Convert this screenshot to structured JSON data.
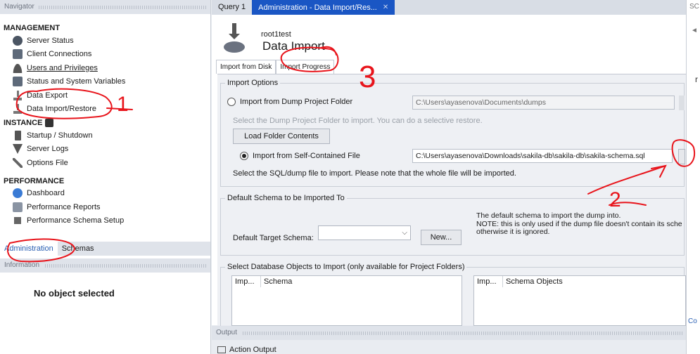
{
  "navigator": {
    "header": "Navigator",
    "sections": [
      {
        "title": "MANAGEMENT",
        "items": [
          {
            "label": "Server Status",
            "icon": "server-status-icon"
          },
          {
            "label": "Client Connections",
            "icon": "client-connections-icon"
          },
          {
            "label": "Users and Privileges",
            "icon": "users-icon"
          },
          {
            "label": "Status and System Variables",
            "icon": "variables-icon"
          },
          {
            "label": "Data Export",
            "icon": "data-export-icon"
          },
          {
            "label": "Data Import/Restore",
            "icon": "data-import-icon"
          }
        ]
      },
      {
        "title": "INSTANCE",
        "items": [
          {
            "label": "Startup / Shutdown",
            "icon": "startup-icon"
          },
          {
            "label": "Server Logs",
            "icon": "server-logs-icon"
          },
          {
            "label": "Options File",
            "icon": "options-file-icon"
          }
        ]
      },
      {
        "title": "PERFORMANCE",
        "items": [
          {
            "label": "Dashboard",
            "icon": "dashboard-icon"
          },
          {
            "label": "Performance Reports",
            "icon": "performance-reports-icon"
          },
          {
            "label": "Performance Schema Setup",
            "icon": "schema-setup-icon"
          }
        ]
      }
    ],
    "tabs": [
      "Administration",
      "Schemas"
    ],
    "info_header": "Information",
    "no_object": "No object selected"
  },
  "doc_tabs": [
    "Query 1",
    "Administration - Data Import/Res..."
  ],
  "page": {
    "connection": "root1test",
    "title": "Data Import",
    "subtabs": [
      "Import from Disk",
      "Import Progress"
    ]
  },
  "import_options": {
    "legend": "Import Options",
    "dump_folder_label": "Import from Dump Project Folder",
    "dump_folder_path": "C:\\Users\\ayasenova\\Documents\\dumps",
    "dump_folder_hint": "Select the Dump Project Folder to import. You can do a selective restore.",
    "load_button": "Load Folder Contents",
    "self_contained_label": "Import from Self-Contained File",
    "self_contained_path": "C:\\Users\\ayasenova\\Downloads\\sakila-db\\sakila-db\\sakila-schema.sql",
    "self_contained_hint": "Select the SQL/dump file to import. Please note that the whole file will be imported."
  },
  "default_schema": {
    "legend": "Default Schema to be Imported To",
    "label": "Default Target Schema:",
    "new_button": "New...",
    "note_1": "The default schema to import the dump into.",
    "note_2": "NOTE: this is only used if the dump file doesn't contain its sche",
    "note_3": "otherwise it is ignored."
  },
  "objects": {
    "legend": "Select Database Objects to Import (only available for Project Folders)",
    "left_cols": [
      "Imp...",
      "Schema"
    ],
    "right_cols": [
      "Imp...",
      "Schema Objects"
    ]
  },
  "output": {
    "header": "Output",
    "row_label": "Action Output"
  },
  "right_strip": {
    "t1": "SC",
    "t2": "◄",
    "t3": "r",
    "t4": "Co"
  },
  "annotations": {
    "n1": "1",
    "n2": "2",
    "n3": "3",
    "color": "#e8141b"
  }
}
